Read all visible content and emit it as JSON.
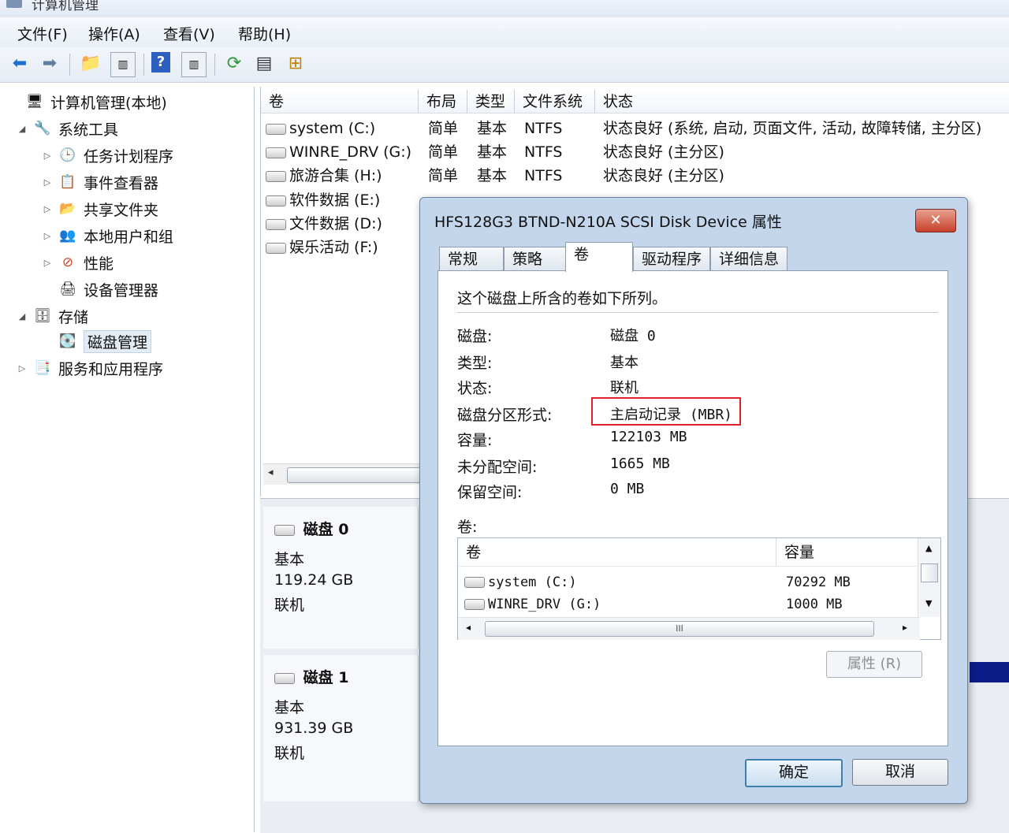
{
  "window": {
    "title": "计算机管理"
  },
  "menu": [
    "文件(F)",
    "操作(A)",
    "查看(V)",
    "帮助(H)"
  ],
  "toolbar_icons": [
    "back-arrow-icon",
    "forward-arrow-icon",
    "up-folder-icon",
    "show-hide-tree-icon",
    "help-icon",
    "console-icon",
    "refresh-icon",
    "properties-icon",
    "export-icon"
  ],
  "tree": [
    {
      "label": "计算机管理(本地)",
      "icon": "computer-management-icon"
    },
    {
      "label": "系统工具",
      "icon": "tools-icon"
    },
    {
      "label": "任务计划程序",
      "icon": "clock-icon"
    },
    {
      "label": "事件查看器",
      "icon": "event-viewer-icon"
    },
    {
      "label": "共享文件夹",
      "icon": "shared-folder-icon"
    },
    {
      "label": "本地用户和组",
      "icon": "users-icon"
    },
    {
      "label": "性能",
      "icon": "performance-icon"
    },
    {
      "label": "设备管理器",
      "icon": "device-manager-icon"
    },
    {
      "label": "存储",
      "icon": "storage-icon"
    },
    {
      "label": "磁盘管理",
      "icon": "disk-management-icon"
    },
    {
      "label": "服务和应用程序",
      "icon": "services-icon"
    }
  ],
  "volume_list": {
    "columns": [
      "卷",
      "布局",
      "类型",
      "文件系统",
      "状态"
    ],
    "rows": [
      {
        "name": "system (C:)",
        "layout": "简单",
        "type": "基本",
        "fs": "NTFS",
        "status": "状态良好 (系统, 启动, 页面文件, 活动, 故障转储, 主分区)"
      },
      {
        "name": "WINRE_DRV (G:)",
        "layout": "简单",
        "type": "基本",
        "fs": "NTFS",
        "status": "状态良好 (主分区)"
      },
      {
        "name": "旅游合集 (H:)",
        "layout": "简单",
        "type": "基本",
        "fs": "NTFS",
        "status": "状态良好 (主分区)"
      },
      {
        "name": "软件数据 (E:)",
        "layout": "",
        "type": "",
        "fs": "",
        "status": ""
      },
      {
        "name": "文件数据 (D:)",
        "layout": "",
        "type": "",
        "fs": "",
        "status": ""
      },
      {
        "name": "娱乐活动 (F:)",
        "layout": "",
        "type": "",
        "fs": "",
        "status": ""
      }
    ]
  },
  "disks": [
    {
      "name": "磁盘 0",
      "type": "基本",
      "size": "119.24 GB",
      "state": "联机"
    },
    {
      "name": "磁盘 1",
      "type": "基本",
      "size": "931.39 GB",
      "state": "联机"
    }
  ],
  "dialog": {
    "title": "HFS128G3 BTND-N210A SCSI Disk Device 属性",
    "close": "✕",
    "tabs": [
      "常规",
      "策略",
      "卷",
      "驱动程序",
      "详细信息"
    ],
    "active_tab": "卷",
    "intro": "这个磁盘上所含的卷如下所列。",
    "props": [
      {
        "label": "磁盘:",
        "value": "磁盘 0"
      },
      {
        "label": "类型:",
        "value": "基本"
      },
      {
        "label": "状态:",
        "value": "联机"
      },
      {
        "label": "磁盘分区形式:",
        "value": "主启动记录 (MBR)"
      },
      {
        "label": "容量:",
        "value": "122103 MB"
      },
      {
        "label": "未分配空间:",
        "value": "1665 MB"
      },
      {
        "label": "保留空间:",
        "value": "0 MB"
      }
    ],
    "volumes_label": "卷:",
    "vol_columns": [
      "卷",
      "容量"
    ],
    "vol_rows": [
      {
        "name": "system (C:)",
        "size": "70292 MB"
      },
      {
        "name": "WINRE_DRV (G:)",
        "size": "1000 MB"
      }
    ],
    "scroll_grip": "III",
    "properties_button": "属性 (R)",
    "ok": "确定",
    "cancel": "取消",
    "highlight_color": "#e0202a"
  }
}
